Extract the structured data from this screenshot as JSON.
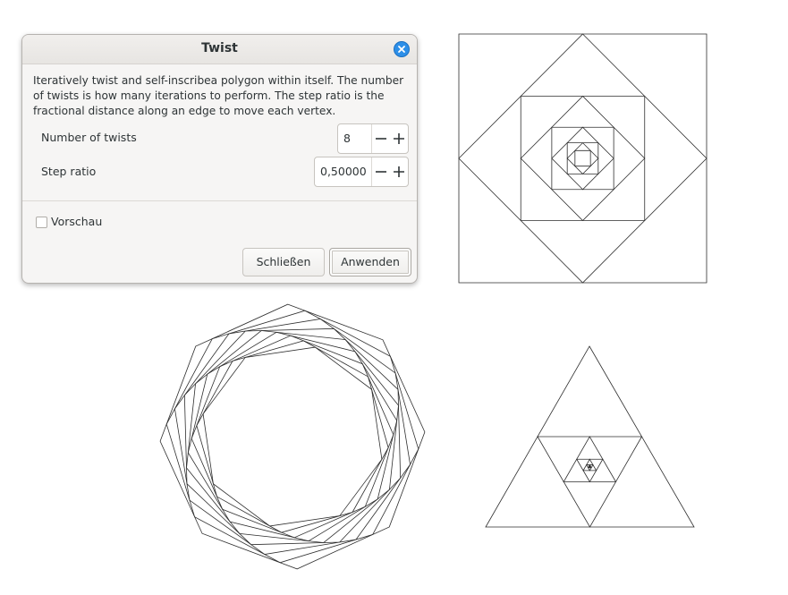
{
  "dialog": {
    "title": "Twist",
    "description": "Iteratively twist and self-inscribea polygon within itself. The number of twists is how many iterations to perform. The step ratio is the fractional distance along an edge to move each vertex.",
    "twists_label": "Number of twists",
    "twists_value": "8",
    "step_label": "Step ratio",
    "step_value": "0,50000",
    "preview_label": "Vorschau",
    "preview_checked": false,
    "close_label": "Schließen",
    "apply_label": "Anwenden"
  },
  "icons": {
    "close": "close-icon",
    "minus": "minus-icon",
    "plus": "plus-icon"
  },
  "colors": {
    "accent": "#2d8fe8",
    "stroke": "#2e2e2e"
  }
}
